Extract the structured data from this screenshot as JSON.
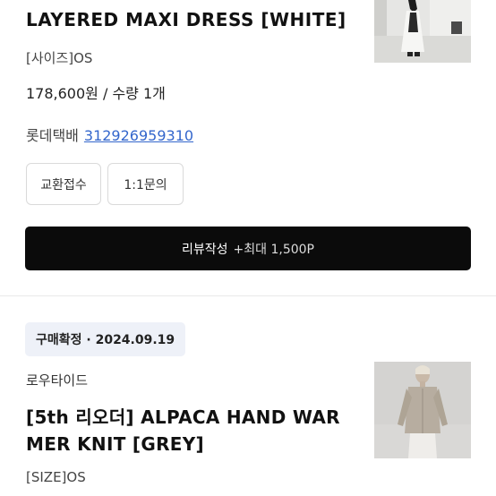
{
  "order1": {
    "product_name": "LAYERED MAXI DRESS [WHITE]",
    "size": "[사이즈]OS",
    "price_quantity": "178,600원 / 수량 1개",
    "courier": "롯데택배",
    "tracking_number": "312926959310",
    "exchange_button": "교환접수",
    "inquiry_button": "1:1문의",
    "review_button": "리뷰작성",
    "review_bonus": "+최대 1,500P"
  },
  "order2": {
    "status_badge": "구매확정 · 2024.09.19",
    "brand": "로우타이드",
    "product_name": "[5th 리오더] ALPACA HAND WAR MER KNIT [GREY]",
    "size": "[SIZE]OS"
  },
  "colors": {
    "review_button_bg": "#0b0b0b",
    "badge_bg": "#eef1f8",
    "link": "#3366cc"
  }
}
